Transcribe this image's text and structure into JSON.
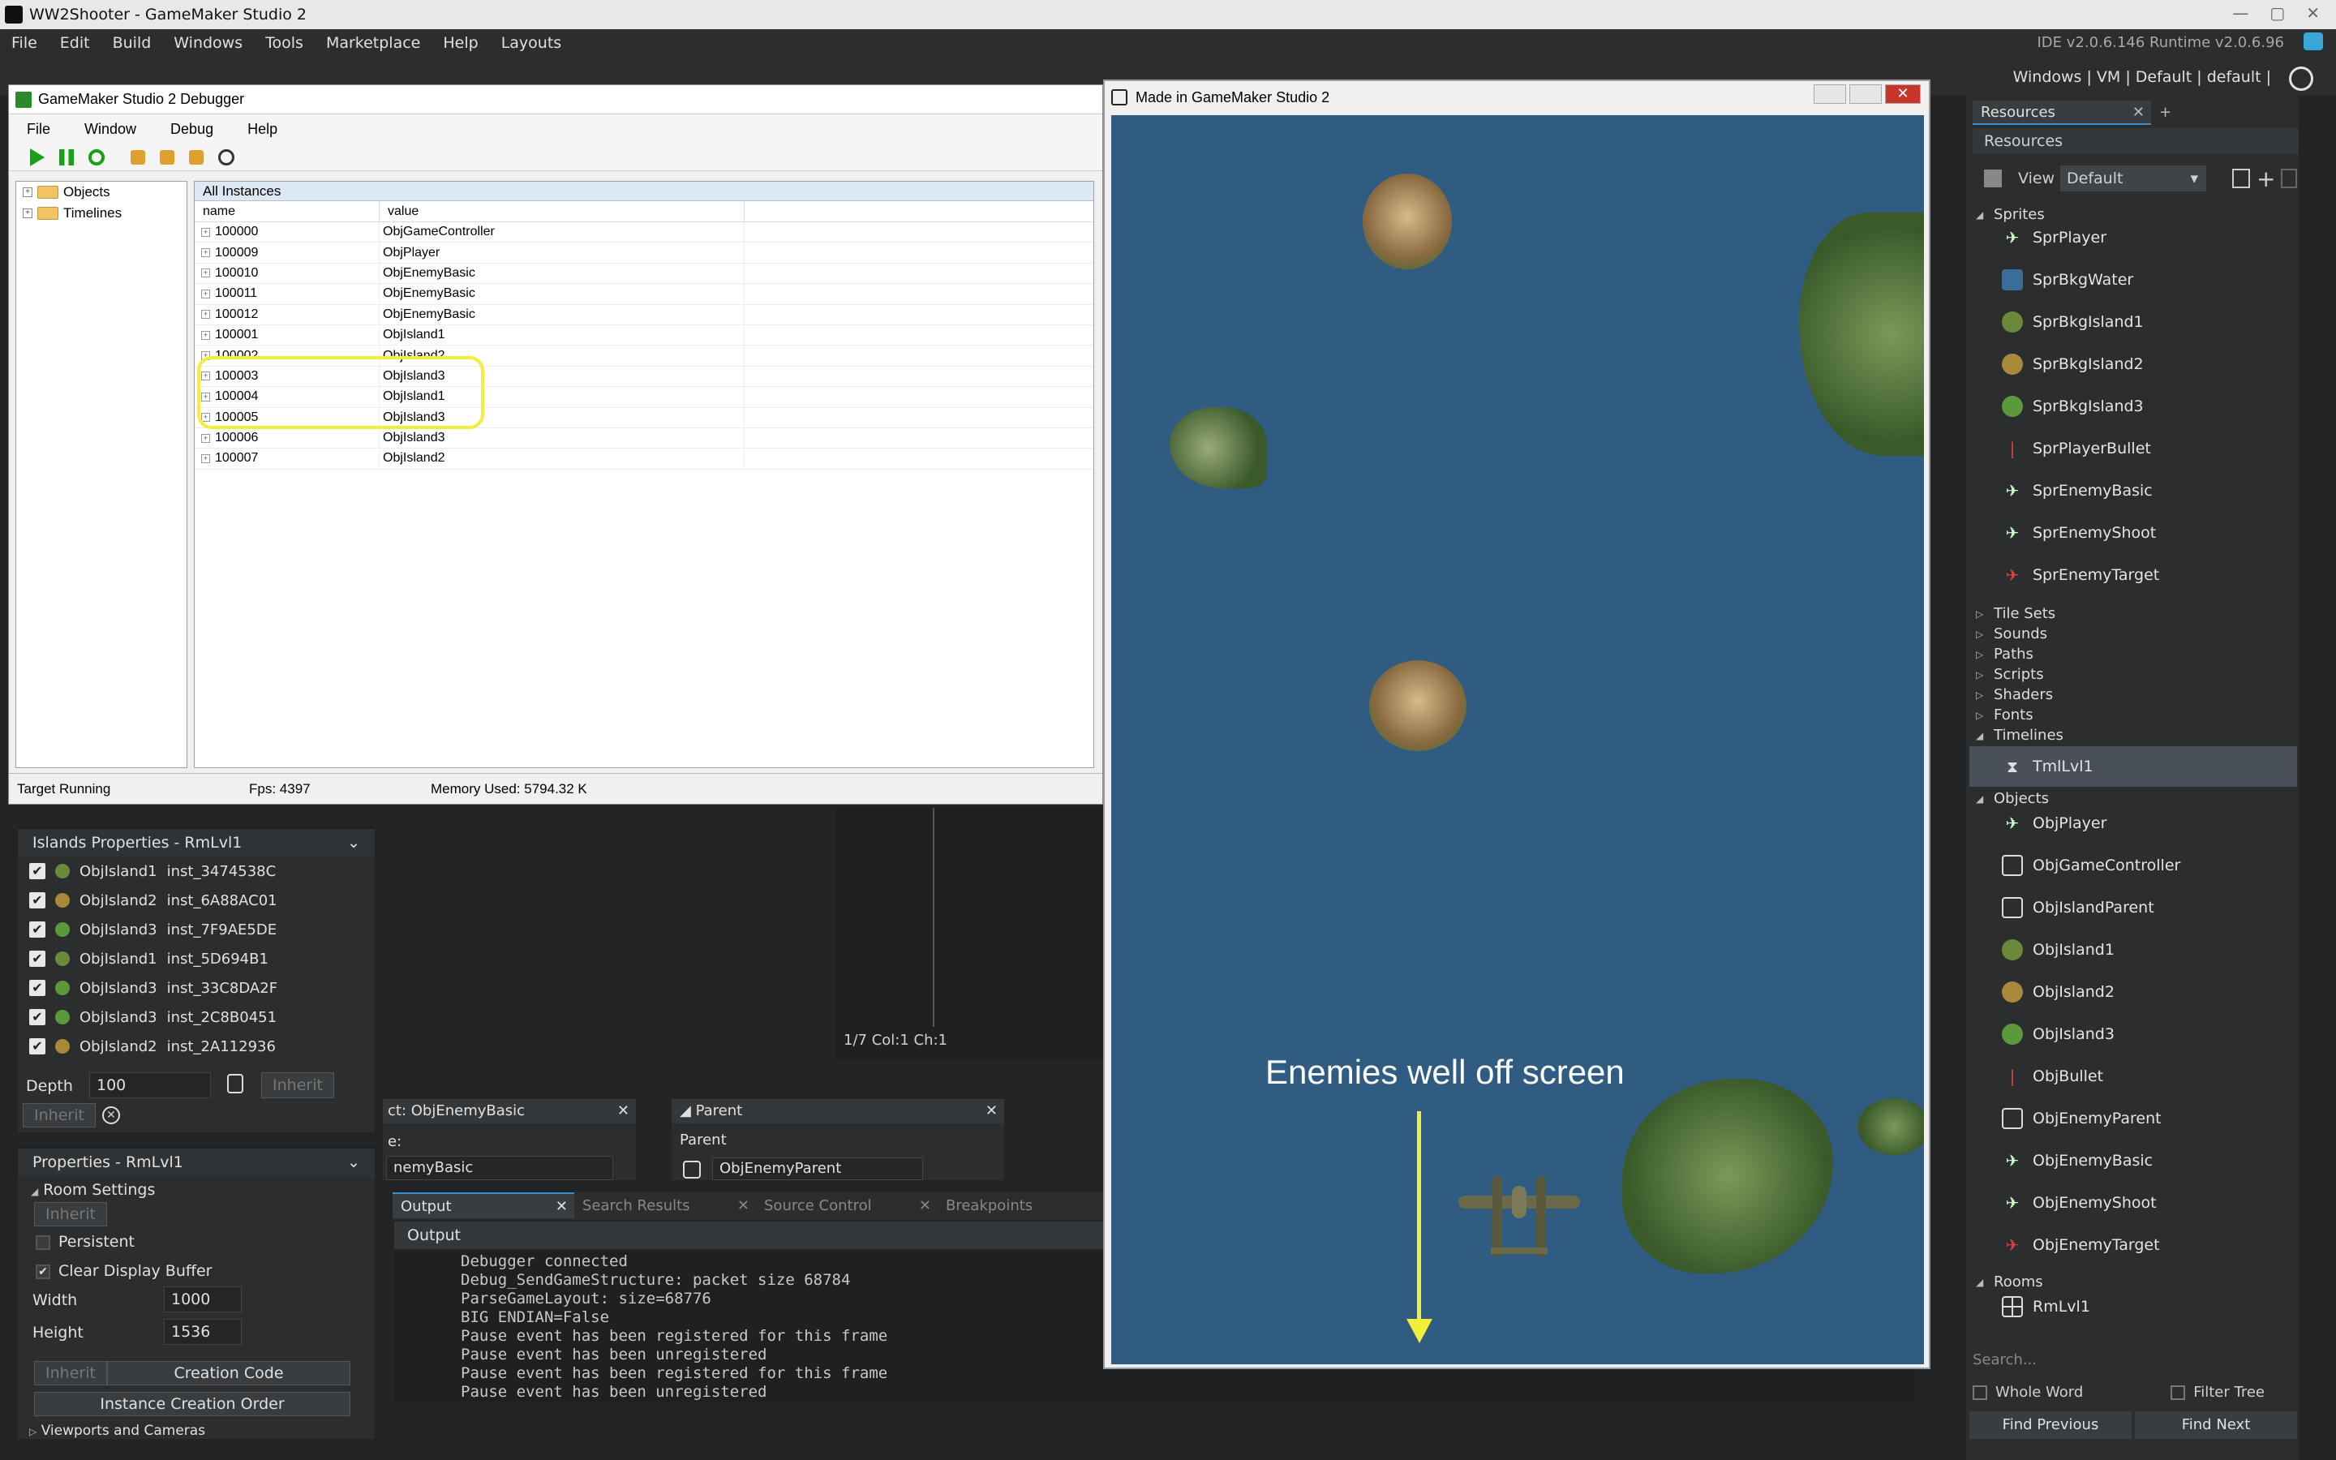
{
  "app": {
    "title": "WW2Shooter - GameMaker Studio 2",
    "menu": [
      "File",
      "Edit",
      "Build",
      "Windows",
      "Tools",
      "Marketplace",
      "Help",
      "Layouts"
    ],
    "version": "IDE v2.0.6.146 Runtime v2.0.6.96",
    "targets": "Windows | VM | Default | default |"
  },
  "debugger": {
    "title": "GameMaker Studio 2 Debugger",
    "menu": [
      "File",
      "Window",
      "Debug",
      "Help"
    ],
    "tree": [
      "Objects",
      "Timelines"
    ],
    "panel_title": "All Instances",
    "col_name": "name",
    "col_value": "value",
    "rows": [
      {
        "name": "100000",
        "value": "ObjGameController"
      },
      {
        "name": "100009",
        "value": "ObjPlayer"
      },
      {
        "name": "100010",
        "value": "ObjEnemyBasic"
      },
      {
        "name": "100011",
        "value": "ObjEnemyBasic"
      },
      {
        "name": "100012",
        "value": "ObjEnemyBasic"
      },
      {
        "name": "100001",
        "value": "ObjIsland1"
      },
      {
        "name": "100002",
        "value": "ObjIsland2"
      },
      {
        "name": "100003",
        "value": "ObjIsland3"
      },
      {
        "name": "100004",
        "value": "ObjIsland1"
      },
      {
        "name": "100005",
        "value": "ObjIsland3"
      },
      {
        "name": "100006",
        "value": "ObjIsland3"
      },
      {
        "name": "100007",
        "value": "ObjIsland2"
      }
    ],
    "status": "Target Running",
    "fps": "Fps: 4397",
    "memory": "Memory Used: 5794.32 K"
  },
  "game": {
    "title": "Made in GameMaker Studio 2",
    "annotation": "Enemies well off screen",
    "close": "✕"
  },
  "resources": {
    "tab": "Resources",
    "header": "Resources",
    "view_label": "View",
    "view_value": "Default",
    "groups": {
      "sprites": "Sprites",
      "tilesets": "Tile Sets",
      "sounds": "Sounds",
      "paths": "Paths",
      "scripts": "Scripts",
      "shaders": "Shaders",
      "fonts": "Fonts",
      "timelines": "Timelines",
      "objects": "Objects",
      "rooms": "Rooms"
    },
    "sprites": [
      "SprPlayer",
      "SprBkgWater",
      "SprBkgIsland1",
      "SprBkgIsland2",
      "SprBkgIsland3",
      "SprPlayerBullet",
      "SprEnemyBasic",
      "SprEnemyShoot",
      "SprEnemyTarget"
    ],
    "timelines": [
      "TmlLvl1"
    ],
    "objects": [
      "ObjPlayer",
      "ObjGameController",
      "ObjIslandParent",
      "ObjIsland1",
      "ObjIsland2",
      "ObjIsland3",
      "ObjBullet",
      "ObjEnemyParent",
      "ObjEnemyBasic",
      "ObjEnemyShoot",
      "ObjEnemyTarget"
    ],
    "rooms": [
      "RmLvl1"
    ],
    "search_placeholder": "Search...",
    "whole_word": "Whole Word",
    "filter_tree": "Filter Tree",
    "find_previous": "Find Previous",
    "find_next": "Find Next"
  },
  "islands_panel": {
    "title": "Islands Properties - RmLvl1",
    "rows": [
      {
        "obj": "ObjIsland1",
        "inst": "inst_3474538C"
      },
      {
        "obj": "ObjIsland2",
        "inst": "inst_6A88AC01"
      },
      {
        "obj": "ObjIsland3",
        "inst": "inst_7F9AE5DE"
      },
      {
        "obj": "ObjIsland1",
        "inst": "inst_5D694B1"
      },
      {
        "obj": "ObjIsland3",
        "inst": "inst_33C8DA2F"
      },
      {
        "obj": "ObjIsland3",
        "inst": "inst_2C8B0451"
      },
      {
        "obj": "ObjIsland2",
        "inst": "inst_2A112936"
      }
    ],
    "depth_label": "Depth",
    "depth_value": "100",
    "inherit": "Inherit"
  },
  "room_props": {
    "title": "Properties - RmLvl1",
    "room_settings": "Room Settings",
    "inherit": "Inherit",
    "persistent": "Persistent",
    "clear_display": "Clear Display Buffer",
    "width_label": "Width",
    "width_value": "1000",
    "height_label": "Height",
    "height_value": "1536",
    "creation_code": "Creation Code",
    "instance_order": "Instance Creation Order",
    "viewports": "Viewports and Cameras"
  },
  "editors": {
    "obj_title": "ct: ObjEnemyBasic",
    "obj_name_frag": "nemyBasic",
    "obj_label_frag": "e:",
    "parent_title": "Parent",
    "parent_label": "Parent",
    "parent_value": "ObjEnemyParent",
    "code_status": "1/7 Col:1 Ch:1"
  },
  "output": {
    "tabs": [
      "Output",
      "Search Results",
      "Source Control",
      "Breakpoints"
    ],
    "header": "Output",
    "lines": [
      "Debugger connected",
      "Debug_SendGameStructure: packet size 68784",
      "ParseGameLayout: size=68776",
      "BIG ENDIAN=False",
      "Pause event has been registered for this frame",
      "Pause event has been unregistered",
      "Pause event has been registered for this frame",
      "Pause event has been unregistered"
    ]
  },
  "colors": {
    "ocean": "#2f5c80",
    "highlight": "#f2ee3a",
    "accent": "#3a8fd0"
  }
}
